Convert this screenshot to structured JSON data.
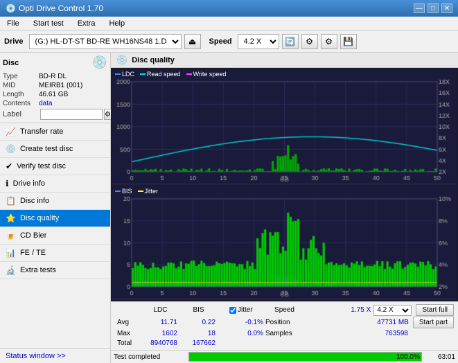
{
  "titlebar": {
    "title": "Opti Drive Control 1.70",
    "icon": "💿",
    "controls": [
      "—",
      "□",
      "✕"
    ]
  },
  "menubar": {
    "items": [
      "File",
      "Start test",
      "Extra",
      "Help"
    ]
  },
  "toolbar": {
    "drive_label": "Drive",
    "drive_value": "(G:)  HL-DT-ST BD-RE  WH16NS48 1.D3",
    "speed_label": "Speed",
    "speed_value": "4.2 X"
  },
  "disc": {
    "header": "Disc",
    "type_label": "Type",
    "type_value": "BD-R DL",
    "mid_label": "MID",
    "mid_value": "MEIRB1 (001)",
    "length_label": "Length",
    "length_value": "46.61 GB",
    "contents_label": "Contents",
    "contents_value": "data",
    "label_label": "Label",
    "label_value": ""
  },
  "nav": {
    "items": [
      {
        "id": "transfer-rate",
        "label": "Transfer rate",
        "icon": "📈"
      },
      {
        "id": "create-test-disc",
        "label": "Create test disc",
        "icon": "💿"
      },
      {
        "id": "verify-test-disc",
        "label": "Verify test disc",
        "icon": "✔"
      },
      {
        "id": "drive-info",
        "label": "Drive info",
        "icon": "ℹ"
      },
      {
        "id": "disc-info",
        "label": "Disc info",
        "icon": "📋"
      },
      {
        "id": "disc-quality",
        "label": "Disc quality",
        "icon": "⭐",
        "active": true
      },
      {
        "id": "cd-bier",
        "label": "CD Bier",
        "icon": "🍺"
      },
      {
        "id": "fe-te",
        "label": "FE / TE",
        "icon": "📊"
      },
      {
        "id": "extra-tests",
        "label": "Extra tests",
        "icon": "🔬"
      }
    ]
  },
  "status_window": {
    "label": "Status window >>",
    "link": true
  },
  "disc_quality": {
    "title": "Disc quality",
    "top_chart": {
      "legend": [
        {
          "label": "LDC",
          "color": "#4444ff"
        },
        {
          "label": "Read speed",
          "color": "#00dddd"
        },
        {
          "label": "Write speed",
          "color": "#ff44ff"
        }
      ],
      "y_max": 2000,
      "y_right_max": 18,
      "x_max": 50,
      "right_labels": [
        "18X",
        "16X",
        "14X",
        "12X",
        "10X",
        "8X",
        "6X",
        "4X",
        "2X"
      ]
    },
    "bottom_chart": {
      "legend": [
        {
          "label": "BIS",
          "color": "#4444ff"
        },
        {
          "label": "Jitter",
          "color": "#ffff00"
        }
      ],
      "y_max": 20,
      "y_right_max": 10,
      "x_max": 50,
      "right_labels": [
        "10%",
        "8%",
        "6%",
        "4%",
        "2%"
      ]
    },
    "stats": {
      "columns": [
        "",
        "LDC",
        "BIS",
        "",
        "Jitter",
        "Speed",
        ""
      ],
      "avg_label": "Avg",
      "avg_ldc": "11.71",
      "avg_bis": "0.22",
      "avg_jitter": "-0.1%",
      "avg_speed": "1.75 X",
      "speed_select": "4.2 X",
      "max_label": "Max",
      "max_ldc": "1602",
      "max_bis": "18",
      "max_jitter": "0.0%",
      "position_label": "Position",
      "position_value": "47731 MB",
      "total_label": "Total",
      "total_ldc": "8940768",
      "total_bis": "167662",
      "samples_label": "Samples",
      "samples_value": "763598",
      "jitter_checked": true,
      "jitter_label": "Jitter",
      "start_full_label": "Start full",
      "start_part_label": "Start part"
    }
  },
  "bottom_status": {
    "text": "Test completed",
    "progress": 100,
    "progress_text": "100.0%",
    "time": "63:01"
  }
}
